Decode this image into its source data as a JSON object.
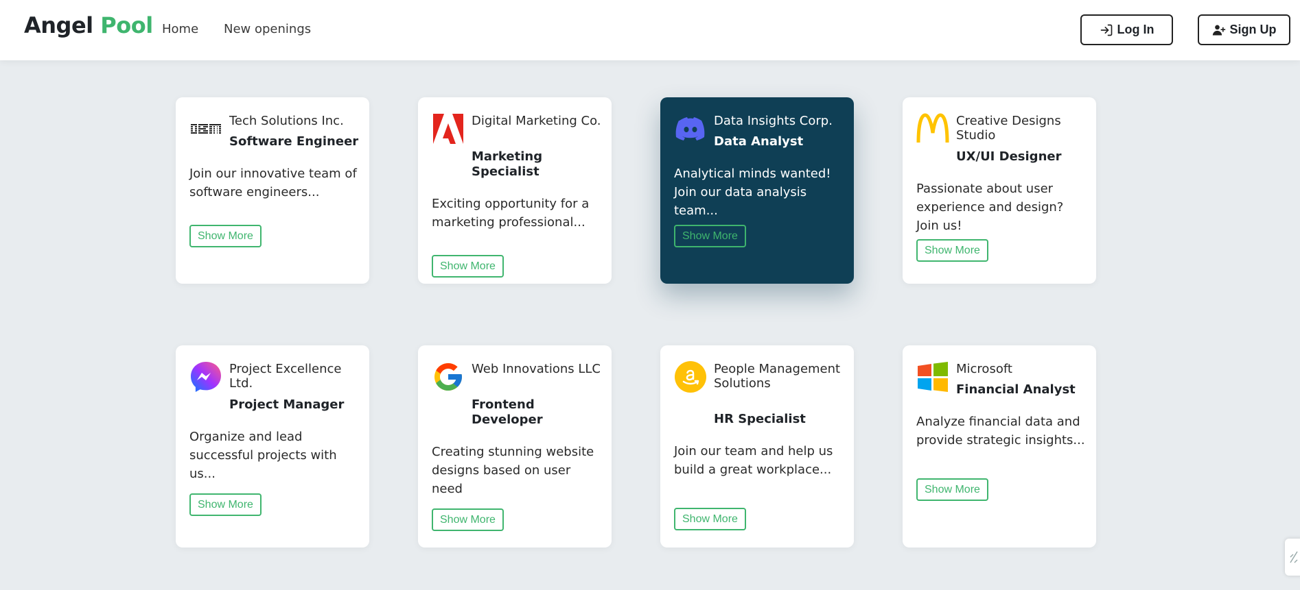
{
  "brand": {
    "part1": "Angel",
    "part2": "Pool"
  },
  "nav": {
    "home": "Home",
    "new_openings": "New openings"
  },
  "auth": {
    "login": "Log In",
    "signup": "Sign Up"
  },
  "colors": {
    "accent": "#3fb56e",
    "dark_card": "#0f3f55",
    "background": "#e8ecef"
  },
  "jobs": [
    {
      "company": "Tech Solutions Inc.",
      "title": "Software Engineer",
      "description": "Join our innovative team of software engineers...",
      "button": "Show More",
      "logo": "ibm-logo"
    },
    {
      "company": "Digital Marketing Co.",
      "title": "Marketing Specialist",
      "description": "Exciting opportunity for a marketing professional...",
      "button": "Show More",
      "logo": "adobe-logo"
    },
    {
      "company": "Data Insights Corp.",
      "title": "Data Analyst",
      "description": "Analytical minds wanted! Join our data analysis team...",
      "button": "Show More",
      "logo": "discord-logo"
    },
    {
      "company": "Creative Designs Studio",
      "title": "UX/UI Designer",
      "description": "Passionate about user experience and design? Join us!",
      "button": "Show More",
      "logo": "mcdonalds-logo"
    },
    {
      "company": "Project Excellence Ltd.",
      "title": "Project Manager",
      "description": "Organize and lead successful projects with us...",
      "button": "Show More",
      "logo": "messenger-logo"
    },
    {
      "company": "Web Innovations LLC",
      "title": "Frontend Developer",
      "description": "Creating stunning website designs based on user need",
      "button": "Show More",
      "logo": "google-logo"
    },
    {
      "company": "People Management Solutions",
      "title": "HR Specialist",
      "description": "Join our team and help us build a great workplace...",
      "button": "Show More",
      "logo": "amazon-logo"
    },
    {
      "company": "Microsoft",
      "title": "Financial Analyst",
      "description": "Analyze financial data and provide strategic insights...",
      "button": "Show More",
      "logo": "microsoft-logo"
    }
  ]
}
